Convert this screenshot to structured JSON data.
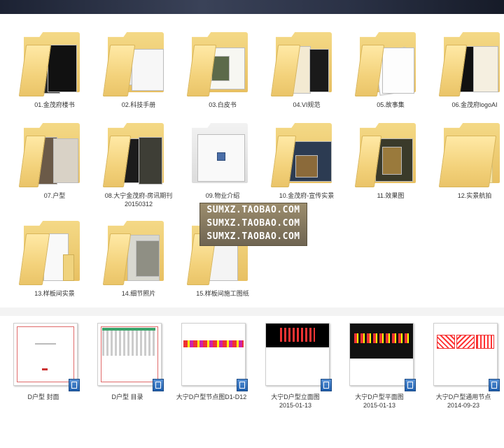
{
  "watermark": {
    "lines": [
      "SUMXZ.TAOBAO.COM",
      "SUMXZ.TAOBAO.COM",
      "SUMXZ.TAOBAO.COM"
    ]
  },
  "folders": [
    {
      "label": "01.金茂府楼书",
      "icon": "folder-icon"
    },
    {
      "label": "02.科技手册",
      "icon": "folder-icon"
    },
    {
      "label": "03.白皮书",
      "icon": "folder-icon"
    },
    {
      "label": "04.VI规范",
      "icon": "folder-icon"
    },
    {
      "label": "05.故事集",
      "icon": "folder-icon"
    },
    {
      "label": "06.金茂府logoAI",
      "icon": "folder-icon"
    },
    {
      "label": "07.户型",
      "icon": "folder-icon"
    },
    {
      "label": "08.大宁金茂府-房讯期刊20150312",
      "icon": "folder-icon"
    },
    {
      "label": "09.物业介绍",
      "icon": "folder-icon"
    },
    {
      "label": "10.金茂府-宣传实景",
      "icon": "folder-icon"
    },
    {
      "label": "11.效果图",
      "icon": "folder-icon"
    },
    {
      "label": "12.实景航拍",
      "icon": "folder-icon"
    },
    {
      "label": "13.样板间实景",
      "icon": "folder-icon"
    },
    {
      "label": "14.细节照片",
      "icon": "folder-icon"
    },
    {
      "label": "15.样板间施工图纸",
      "icon": "folder-icon"
    }
  ],
  "files": [
    {
      "name": "D户型 封面",
      "date": "",
      "icon": "cad-file-icon"
    },
    {
      "name": "D户型 目录",
      "date": "",
      "icon": "cad-file-icon"
    },
    {
      "name": "大宁D户型节点图D1-D12",
      "date": "",
      "icon": "cad-file-icon"
    },
    {
      "name": "大宁D户型立面图",
      "date": "2015-01-13",
      "icon": "cad-file-icon"
    },
    {
      "name": "大宁D户型平面图",
      "date": "2015-01-13",
      "icon": "cad-file-icon"
    },
    {
      "name": "大宁D户型通用节点",
      "date": "2014-09-23",
      "icon": "cad-file-icon"
    }
  ]
}
